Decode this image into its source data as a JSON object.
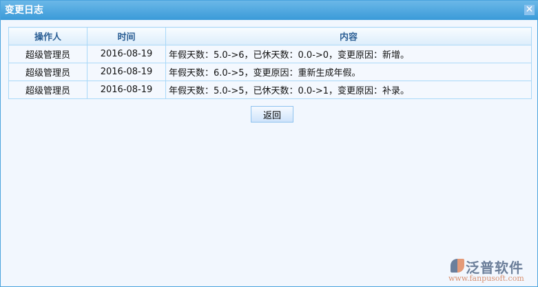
{
  "window": {
    "title": "变更日志",
    "close_label": "✕"
  },
  "table": {
    "headers": [
      "操作人",
      "时间",
      "内容"
    ],
    "rows": [
      [
        "超级管理员",
        "2016-08-19",
        "年假天数：5.0->6，已休天数：0.0->0，变更原因：新增。"
      ],
      [
        "超级管理员",
        "2016-08-19",
        "年假天数：6.0->5，变更原因：重新生成年假。"
      ],
      [
        "超级管理员",
        "2016-08-19",
        "年假天数：5.0->5，已休天数：0.0->1，变更原因：补录。"
      ]
    ]
  },
  "back_label": "返回",
  "watermark": {
    "name": "泛普软件",
    "url": "www.fanpusoft.com"
  }
}
